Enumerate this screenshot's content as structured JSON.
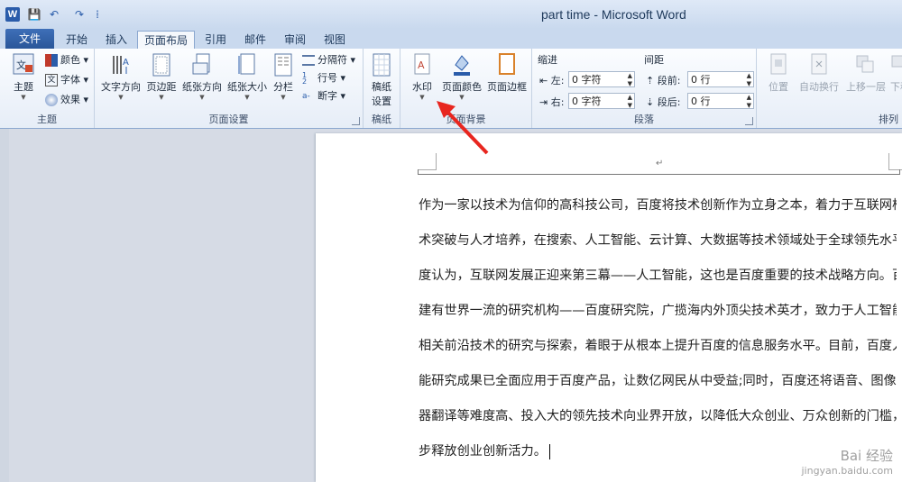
{
  "window": {
    "title": "part time - Microsoft Word",
    "logo_letter": "W"
  },
  "qat": {
    "save": "💾",
    "undo": "↶",
    "redo": "↷",
    "more": "⁞"
  },
  "tabs": [
    {
      "label": "文件"
    },
    {
      "label": "开始"
    },
    {
      "label": "插入"
    },
    {
      "label": "页面布局"
    },
    {
      "label": "引用"
    },
    {
      "label": "邮件"
    },
    {
      "label": "审阅"
    },
    {
      "label": "视图"
    }
  ],
  "ribbon": {
    "themes": {
      "group_label": "主题",
      "theme_btn": "主题",
      "colors": "颜色",
      "fonts": "字体",
      "effects": "效果"
    },
    "page_setup": {
      "group_label": "页面设置",
      "text_direction": "文字方向",
      "margins": "页边距",
      "orientation": "纸张方向",
      "size": "纸张大小",
      "columns": "分栏",
      "breaks": "分隔符",
      "line_numbers": "行号",
      "hyphenation": "断字"
    },
    "manuscript": {
      "group_label": "稿纸",
      "btn_line1": "稿纸",
      "btn_line2": "设置"
    },
    "page_background": {
      "group_label": "页面背景",
      "watermark": "水印",
      "page_color": "页面颜色",
      "page_borders": "页面边框"
    },
    "paragraph": {
      "group_label": "段落",
      "indent_label": "缩进",
      "spacing_label": "间距",
      "left_label": "左:",
      "right_label": "右:",
      "before_label": "段前:",
      "after_label": "段后:",
      "left_value": "0 字符",
      "right_value": "0 字符",
      "before_value": "0 行",
      "after_value": "0 行"
    },
    "arrange": {
      "group_label": "排列",
      "position": "位置",
      "wrap_text": "自动换行",
      "bring_forward": "上移一层",
      "send_backward": "下移"
    }
  },
  "document": {
    "paragraph_mark": "↵",
    "lines": [
      "作为一家以技术为信仰的高科技公司，百度将技术创新作为立身之本，着力于互联网核心技",
      "术突破与人才培养，在搜索、人工智能、云计算、大数据等技术领域处于全球领先水平。百",
      "度认为，互联网发展正迎来第三幕——人工智能，这也是百度重要的技术战略方向。百度",
      "建有世界一流的研究机构——百度研究院，广揽海内外顶尖技术英才，致力于人工智能等",
      "相关前沿技术的研究与探索，着眼于从根本上提升百度的信息服务水平。目前，百度人工智",
      "能研究成果已全面应用于百度产品，让数亿网民从中受益;同时，百度还将语音、图像、机",
      "器翻译等难度高、投入大的领先技术向业界开放，以降低大众创业、万众创新的门槛，进一",
      "步释放创业创新活力。"
    ]
  },
  "watermark": {
    "line1": "Bai 经验",
    "line2": "jingyan.baidu.com"
  }
}
